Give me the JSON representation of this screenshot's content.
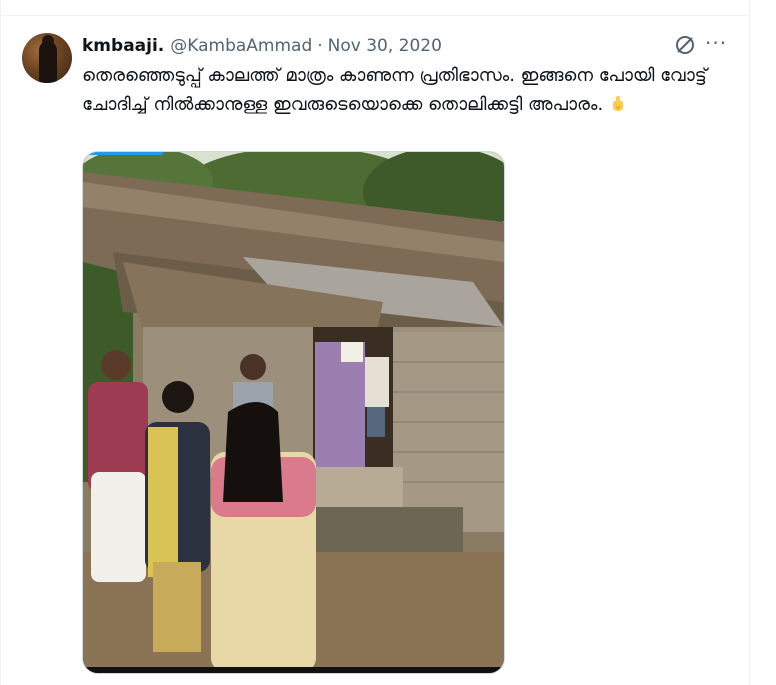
{
  "tweet": {
    "display_name": "kmbaaji.",
    "handle": "@KambaAmmad",
    "separator": "·",
    "date": "Nov 30, 2020",
    "text": "തെരഞ്ഞെടുപ്പ് കാലത്ത് മാത്രം കാണുന്ന പ്രതിഭാസം. ഇങ്ങനെ പോയി വോട്ട് ചോദിച്ച് നിൽക്കാനുള്ള ഇവരുടെയൊക്കെ തൊലിക്കട്ടി അപാരം.",
    "emoji": "pointing-down-emoji",
    "more_label": "···",
    "icons": {
      "grok": "grok-icon",
      "more": "more-icon"
    }
  },
  "colors": {
    "text_primary": "#0f1419",
    "text_secondary": "#536471",
    "accent": "#1d9bf0",
    "border": "#cfd9de"
  }
}
